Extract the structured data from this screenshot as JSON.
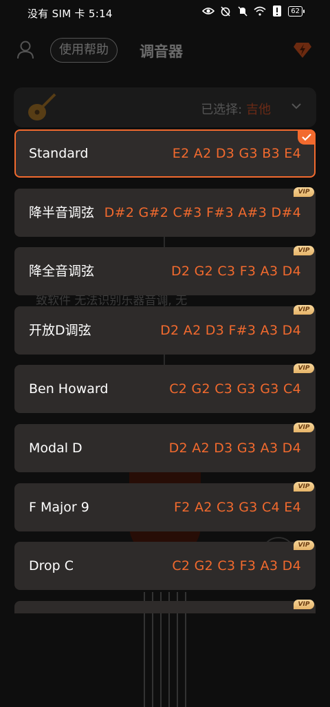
{
  "status_bar": {
    "carrier": "没有 SIM 卡 5:14",
    "battery": "62"
  },
  "header": {
    "help_label": "使用帮助",
    "title": "调音器"
  },
  "selector": {
    "prefix": "已选择:",
    "value": "吉他"
  },
  "background_hint": "致软件 无法识别乐器音调, 无",
  "tunings": [
    {
      "name": "Standard",
      "notes": "E2 A2 D3 G3 B3 E4",
      "selected": true,
      "vip": false
    },
    {
      "name": "降半音调弦",
      "notes": "D#2 G#2 C#3 F#3 A#3 D#4",
      "selected": false,
      "vip": true
    },
    {
      "name": "降全音调弦",
      "notes": "D2 G2 C3 F3 A3 D4",
      "selected": false,
      "vip": true
    },
    {
      "name": "开放D调弦",
      "notes": "D2 A2 D3 F#3 A3 D4",
      "selected": false,
      "vip": true
    },
    {
      "name": "Ben Howard",
      "notes": "C2 G2 C3 G3 G3 C4",
      "selected": false,
      "vip": true
    },
    {
      "name": "Modal D",
      "notes": "D2 A2 D3 G3 A3 D4",
      "selected": false,
      "vip": true
    },
    {
      "name": "F Major 9",
      "notes": "F2 A2 C3 G3 C4 E4",
      "selected": false,
      "vip": true
    },
    {
      "name": "Drop C",
      "notes": "C2 G2 C3 F3 A3 D4",
      "selected": false,
      "vip": true
    },
    {
      "name": "",
      "notes": "",
      "selected": false,
      "vip": true
    }
  ],
  "vip_label": "VIP",
  "colors": {
    "accent": "#f26a2e",
    "card": "#2e2b2a",
    "vip_gold": "#e6b469"
  }
}
